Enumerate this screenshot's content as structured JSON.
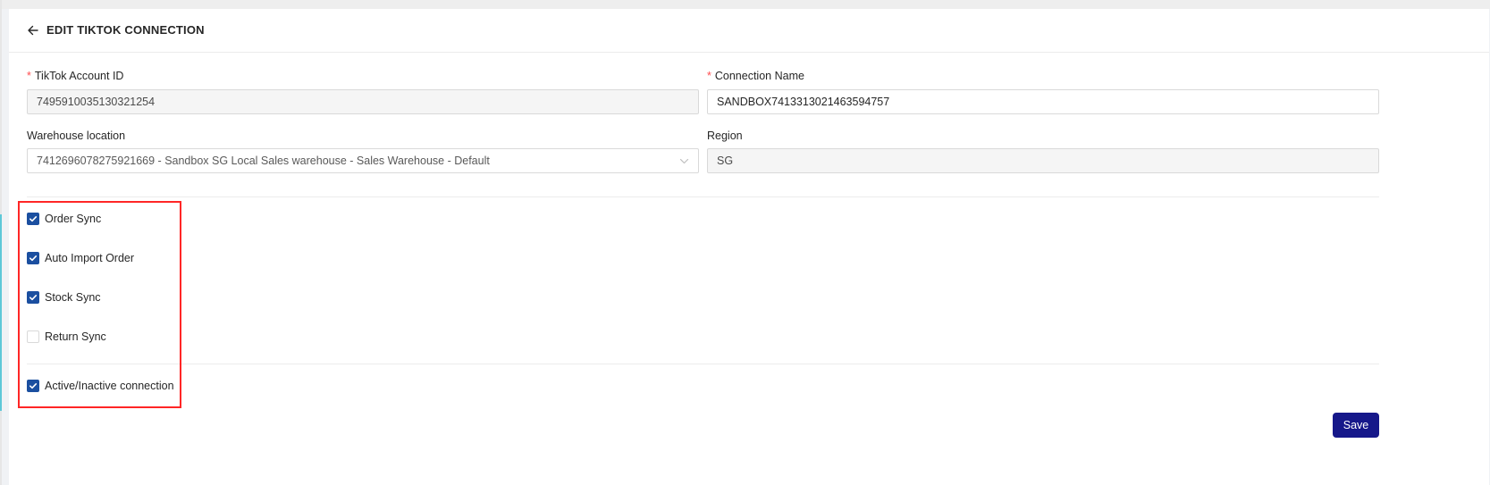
{
  "header": {
    "title": "EDIT TIKTOK CONNECTION",
    "back_icon": "arrow-left-icon"
  },
  "form": {
    "account_id": {
      "label": "TikTok Account ID",
      "required_mark": "*",
      "value": "7495910035130321254"
    },
    "connection_name": {
      "label": "Connection Name",
      "required_mark": "*",
      "value": "SANDBOX7413313021463594757"
    },
    "warehouse": {
      "label": "Warehouse location",
      "value": "7412696078275921669 - Sandbox SG Local Sales warehouse - Sales Warehouse - Default"
    },
    "region": {
      "label": "Region",
      "value": "SG"
    }
  },
  "checkboxes": [
    {
      "label": "Order Sync",
      "checked": true
    },
    {
      "label": "Auto Import Order",
      "checked": true
    },
    {
      "label": "Stock Sync",
      "checked": true
    },
    {
      "label": "Return Sync",
      "checked": false
    }
  ],
  "active_toggle": {
    "label": "Active/Inactive connection",
    "checked": true
  },
  "save_label": "Save",
  "colors": {
    "primary": "#16188a",
    "checkbox": "#1b4fa0",
    "required": "#ff4d4f",
    "highlight": "#ff2626"
  }
}
